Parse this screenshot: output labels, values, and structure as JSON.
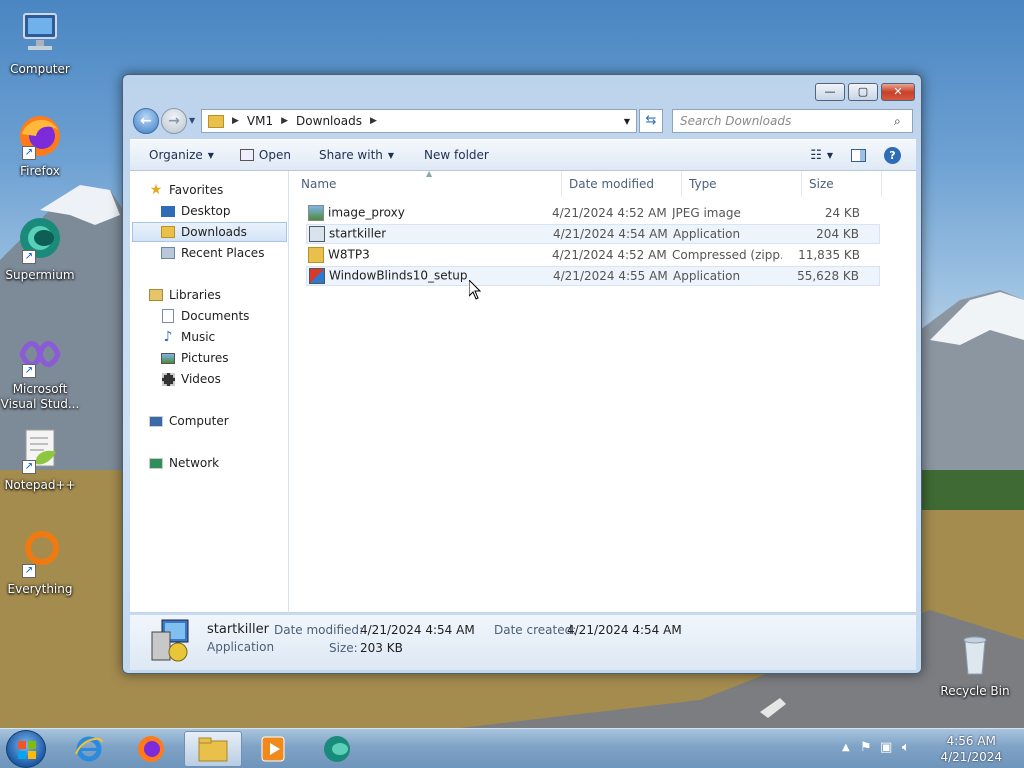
{
  "desktop": {
    "icons": [
      {
        "label": "Computer"
      },
      {
        "label": "Firefox"
      },
      {
        "label": "Supermium"
      },
      {
        "label": "Microsoft Visual Stud..."
      },
      {
        "label": "Notepad++"
      },
      {
        "label": "Everything"
      },
      {
        "label": "Recycle Bin"
      }
    ]
  },
  "window": {
    "controls": {
      "minimize": "—",
      "maximize": "▢",
      "close": "✕"
    },
    "address": {
      "segments": [
        "VM1",
        "Downloads"
      ]
    },
    "search": {
      "placeholder": "Search Downloads"
    },
    "toolbar": {
      "organize": "Organize",
      "open": "Open",
      "share_with": "Share with",
      "new_folder": "New folder"
    },
    "nav": {
      "favorites": "Favorites",
      "desktop": "Desktop",
      "downloads": "Downloads",
      "recent_places": "Recent Places",
      "libraries": "Libraries",
      "documents": "Documents",
      "music": "Music",
      "pictures": "Pictures",
      "videos": "Videos",
      "computer": "Computer",
      "network": "Network"
    },
    "columns": {
      "name": "Name",
      "date_modified": "Date modified",
      "type": "Type",
      "size": "Size"
    },
    "files": [
      {
        "name": "image_proxy",
        "date": "4/21/2024 4:52 AM",
        "type": "JPEG image",
        "size": "24 KB",
        "icon": "image-file-icon"
      },
      {
        "name": "startkiller",
        "date": "4/21/2024 4:54 AM",
        "type": "Application",
        "size": "204 KB",
        "icon": "application-icon"
      },
      {
        "name": "W8TP3",
        "date": "4/21/2024 4:52 AM",
        "type": "Compressed (zipp...",
        "size": "11,835 KB",
        "icon": "zip-folder-icon"
      },
      {
        "name": "WindowBlinds10_setup",
        "date": "4/21/2024 4:55 AM",
        "type": "Application",
        "size": "55,628 KB",
        "icon": "installer-icon"
      }
    ],
    "details": {
      "name": "startkiller",
      "type": "Application",
      "date_modified_label": "Date modified:",
      "date_modified": "4/21/2024 4:54 AM",
      "date_created_label": "Date created:",
      "date_created": "4/21/2024 4:54 AM",
      "size_label": "Size:",
      "size": "203 KB"
    }
  },
  "taskbar": {
    "time": "4:56 AM",
    "date": "4/21/2024"
  },
  "colors": {
    "accent": "#3a7cc5",
    "selection": "#d3e4f7",
    "close": "#c8412a"
  }
}
